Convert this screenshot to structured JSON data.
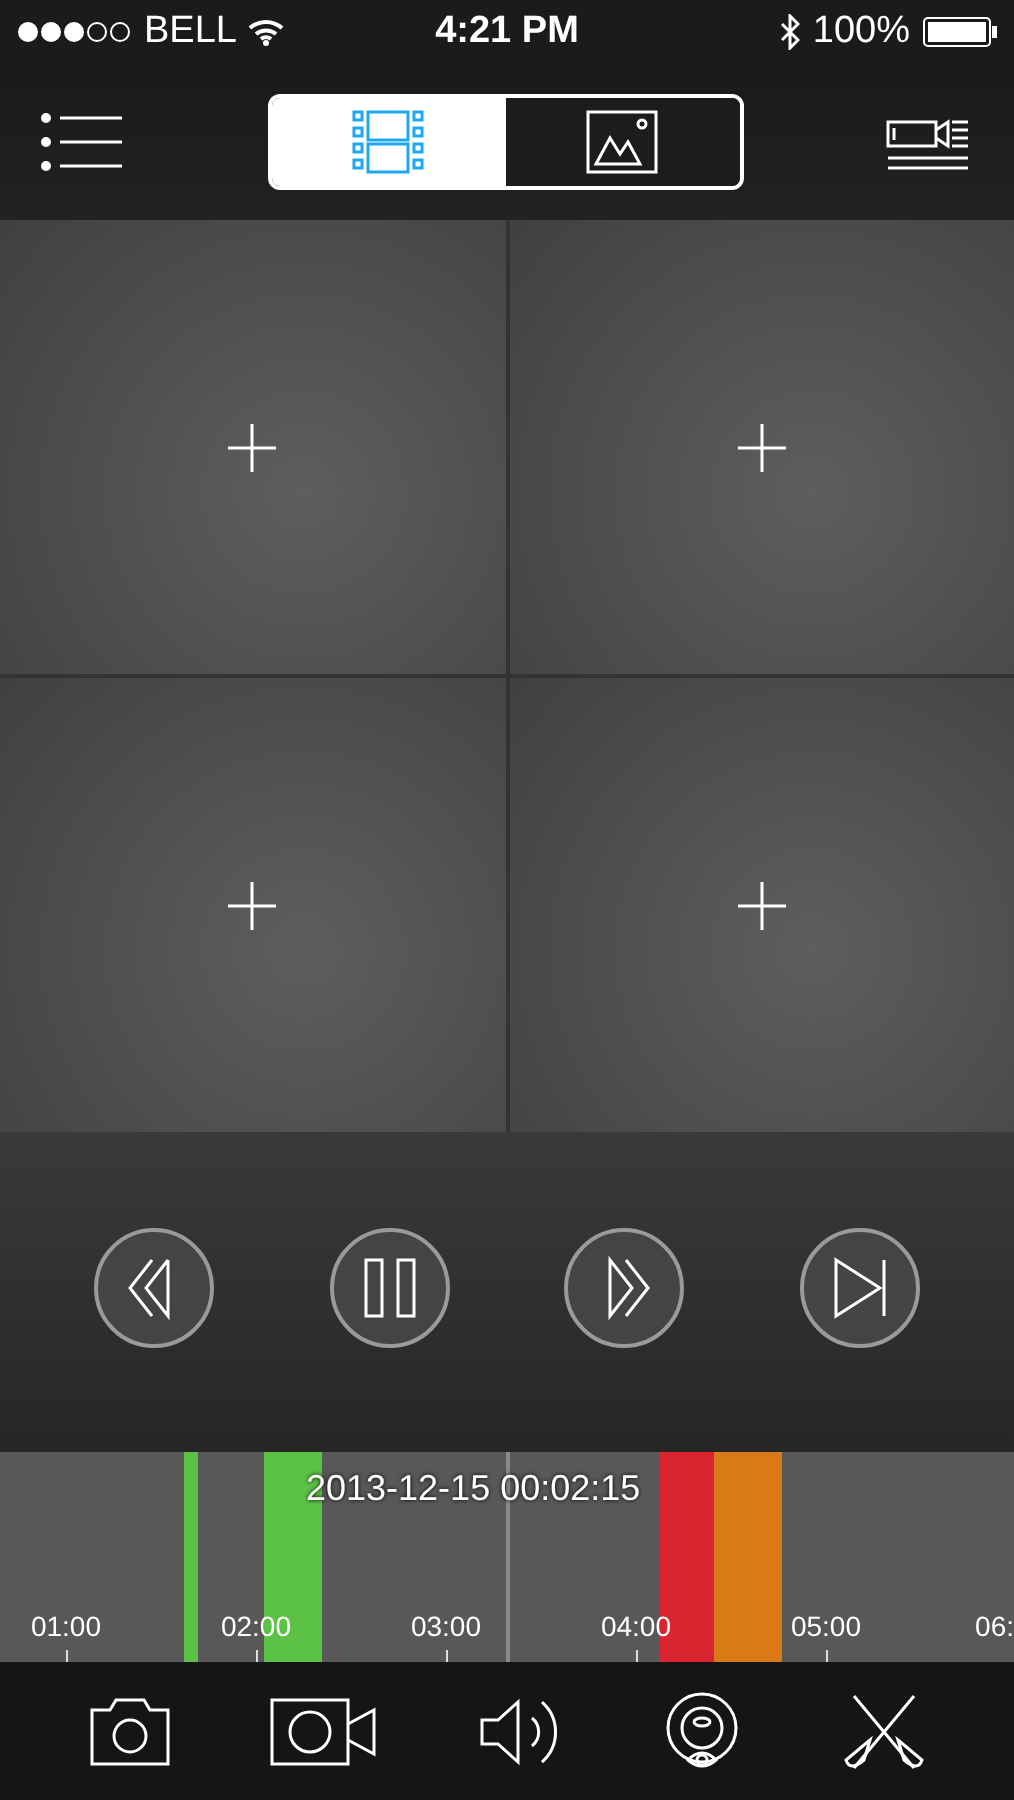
{
  "status_bar": {
    "carrier": "BELL",
    "time": "4:21 PM",
    "battery": "100%"
  },
  "view_tabs": [
    {
      "kind": "video",
      "selected": true
    },
    {
      "kind": "image",
      "selected": false
    }
  ],
  "video_cells": [
    {
      "kind": "empty"
    },
    {
      "kind": "empty"
    },
    {
      "kind": "empty"
    },
    {
      "kind": "empty"
    }
  ],
  "playback_controls": [
    {
      "kind": "rewind"
    },
    {
      "kind": "pause"
    },
    {
      "kind": "forward"
    },
    {
      "kind": "next"
    }
  ],
  "timeline": {
    "datetime": "2013-12-15 00:02:15",
    "ticks": [
      "01:00",
      "02:00",
      "03:00",
      "04:00",
      "05:00",
      "06:"
    ],
    "segments": [
      {
        "color": "#5cc245"
      },
      {
        "color": "#5cc245"
      },
      {
        "color": "#da2430"
      },
      {
        "color": "#d97917"
      }
    ]
  },
  "toolbar": [
    {
      "kind": "camera"
    },
    {
      "kind": "record"
    },
    {
      "kind": "sound"
    },
    {
      "kind": "eye"
    },
    {
      "kind": "scissors"
    }
  ]
}
